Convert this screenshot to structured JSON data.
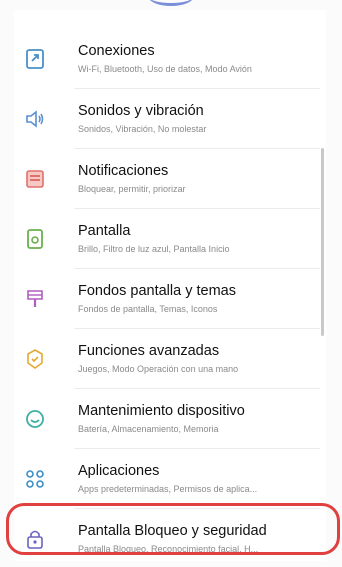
{
  "settings": {
    "items": [
      {
        "title": "Conexiones",
        "subtitle": "Wi-Fi, Bluetooth, Uso de datos, Modo Avión",
        "icon": "connections-icon",
        "color": "#4a90c8"
      },
      {
        "title": "Sonidos y vibración",
        "subtitle": "Sonidos, Vibración, No molestar",
        "icon": "speaker-icon",
        "color": "#5a8fd0"
      },
      {
        "title": "Notificaciones",
        "subtitle": "Bloquear, permitir, priorizar",
        "icon": "notifications-icon",
        "color": "#e0706a"
      },
      {
        "title": "Pantalla",
        "subtitle": "Brillo, Filtro de luz azul, Pantalla Inicio",
        "icon": "display-icon",
        "color": "#6ab04c"
      },
      {
        "title": "Fondos pantalla y temas",
        "subtitle": "Fondos de pantalla, Temas, Iconos",
        "icon": "brush-icon",
        "color": "#b05ec0"
      },
      {
        "title": "Funciones avanzadas",
        "subtitle": "Juegos, Modo Operación con una mano",
        "icon": "advanced-features-icon",
        "color": "#e5a836"
      },
      {
        "title": "Mantenimiento dispositivo",
        "subtitle": "Batería, Almacenamiento, Memoria",
        "icon": "device-care-icon",
        "color": "#3fb0a0"
      },
      {
        "title": "Aplicaciones",
        "subtitle": "Apps predeterminadas, Permisos de aplica...",
        "icon": "apps-icon",
        "color": "#3a8fc8"
      },
      {
        "title": "Pantalla Bloqueo y seguridad",
        "subtitle": "Pantalla Bloqueo, Reconocimiento facial, H...",
        "icon": "lock-icon",
        "color": "#6a63c0"
      }
    ]
  }
}
